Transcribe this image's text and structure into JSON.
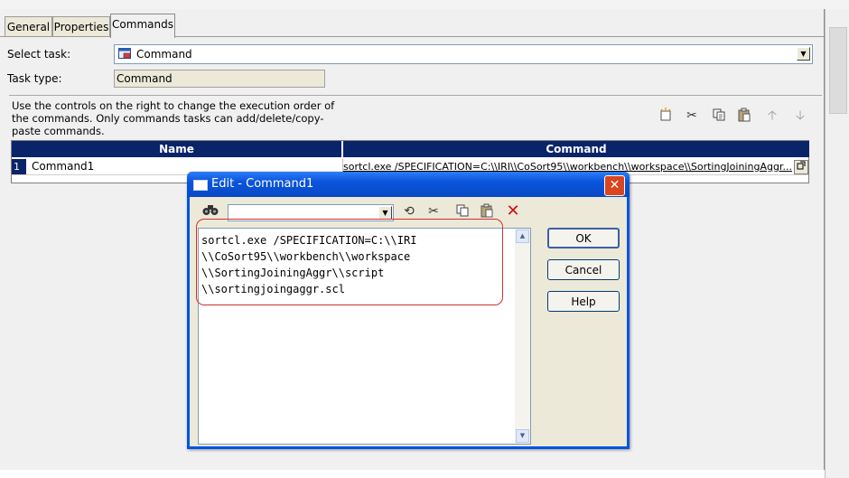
{
  "tabs": [
    {
      "label": "General"
    },
    {
      "label": "Properties"
    },
    {
      "label": "Commands"
    }
  ],
  "fields": {
    "select_task_label": "Select task:",
    "select_task_value": "Command",
    "task_type_label": "Task type:",
    "task_type_value": "Command"
  },
  "description": "Use the controls on the right to change the execution order of the commands.  Only commands tasks can add/delete/copy-paste commands.",
  "toolbar_icons": [
    "new-icon",
    "cut-icon",
    "copy-icon",
    "paste-icon",
    "move-up-icon",
    "move-down-icon"
  ],
  "grid": {
    "columns": [
      "Name",
      "Command"
    ],
    "rows": [
      {
        "num": "1",
        "name": "Command1",
        "command": "sortcl.exe /SPECIFICATION=C:\\\\IRI\\\\CoSort95\\\\workbench\\\\workspace\\\\SortingJoiningAggr..."
      }
    ]
  },
  "dialog": {
    "title": "Edit  - Command1",
    "close_glyph": "✕",
    "find_value": "",
    "editor_text": "sortcl.exe /SPECIFICATION=C:\\\\IRI\n\\\\CoSort95\\\\workbench\\\\workspace\n\\\\SortingJoiningAggr\\\\script\n\\\\sortingjoingaggr.scl",
    "buttons": {
      "ok": "OK",
      "cancel": "Cancel",
      "help": "Help"
    },
    "toolbar_icons": [
      "binoculars-icon",
      "undo-icon",
      "cut-icon",
      "copy-icon",
      "paste-icon",
      "delete-icon"
    ]
  },
  "colors": {
    "titlebar": "#0a55dd",
    "grid_header": "#0a246a",
    "highlight_oval": "#d23030"
  }
}
